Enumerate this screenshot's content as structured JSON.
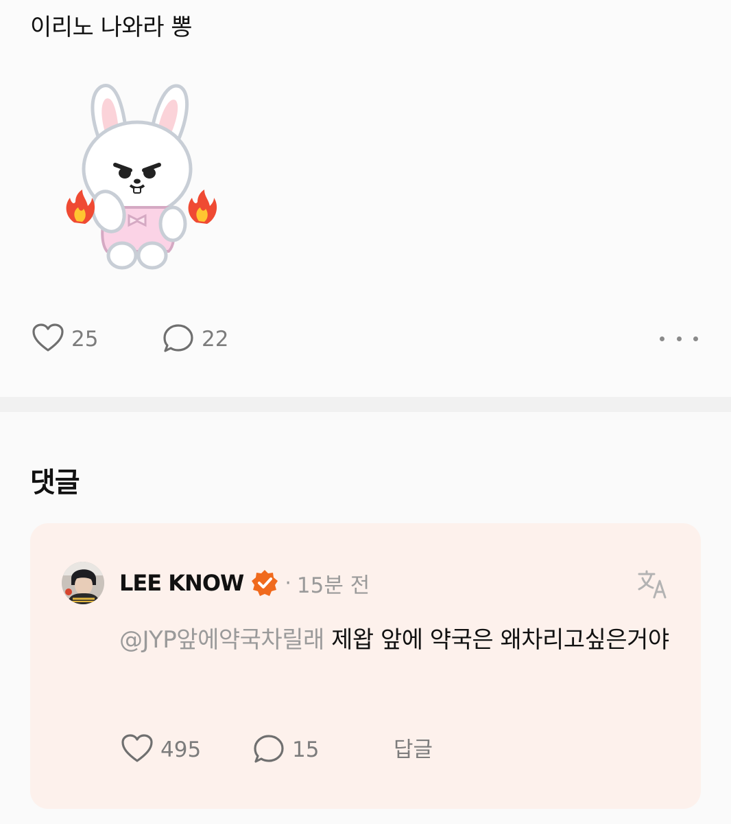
{
  "post": {
    "text": "이리노 나와라 뽕",
    "sticker": "angry-bunny-sticker",
    "likes": "25",
    "comments": "22"
  },
  "comments_section": {
    "heading": "댓글"
  },
  "comment": {
    "author": "LEE KNOW",
    "separator": "·",
    "time": "15분 전",
    "mention": "@JYP앞에약국차릴래",
    "text": " 제왑 앞에 약국은 왜차리고싶은거야",
    "likes": "495",
    "replies": "15",
    "reply_label": "답글"
  },
  "colors": {
    "background": "#fafafa",
    "card": "#fdf1ec",
    "verified_badge": "#f06a1d",
    "muted_text": "#7c7c7c"
  },
  "icons": [
    "heart-icon",
    "speech-bubble-icon",
    "more-icon",
    "verified-icon",
    "translate-icon"
  ]
}
